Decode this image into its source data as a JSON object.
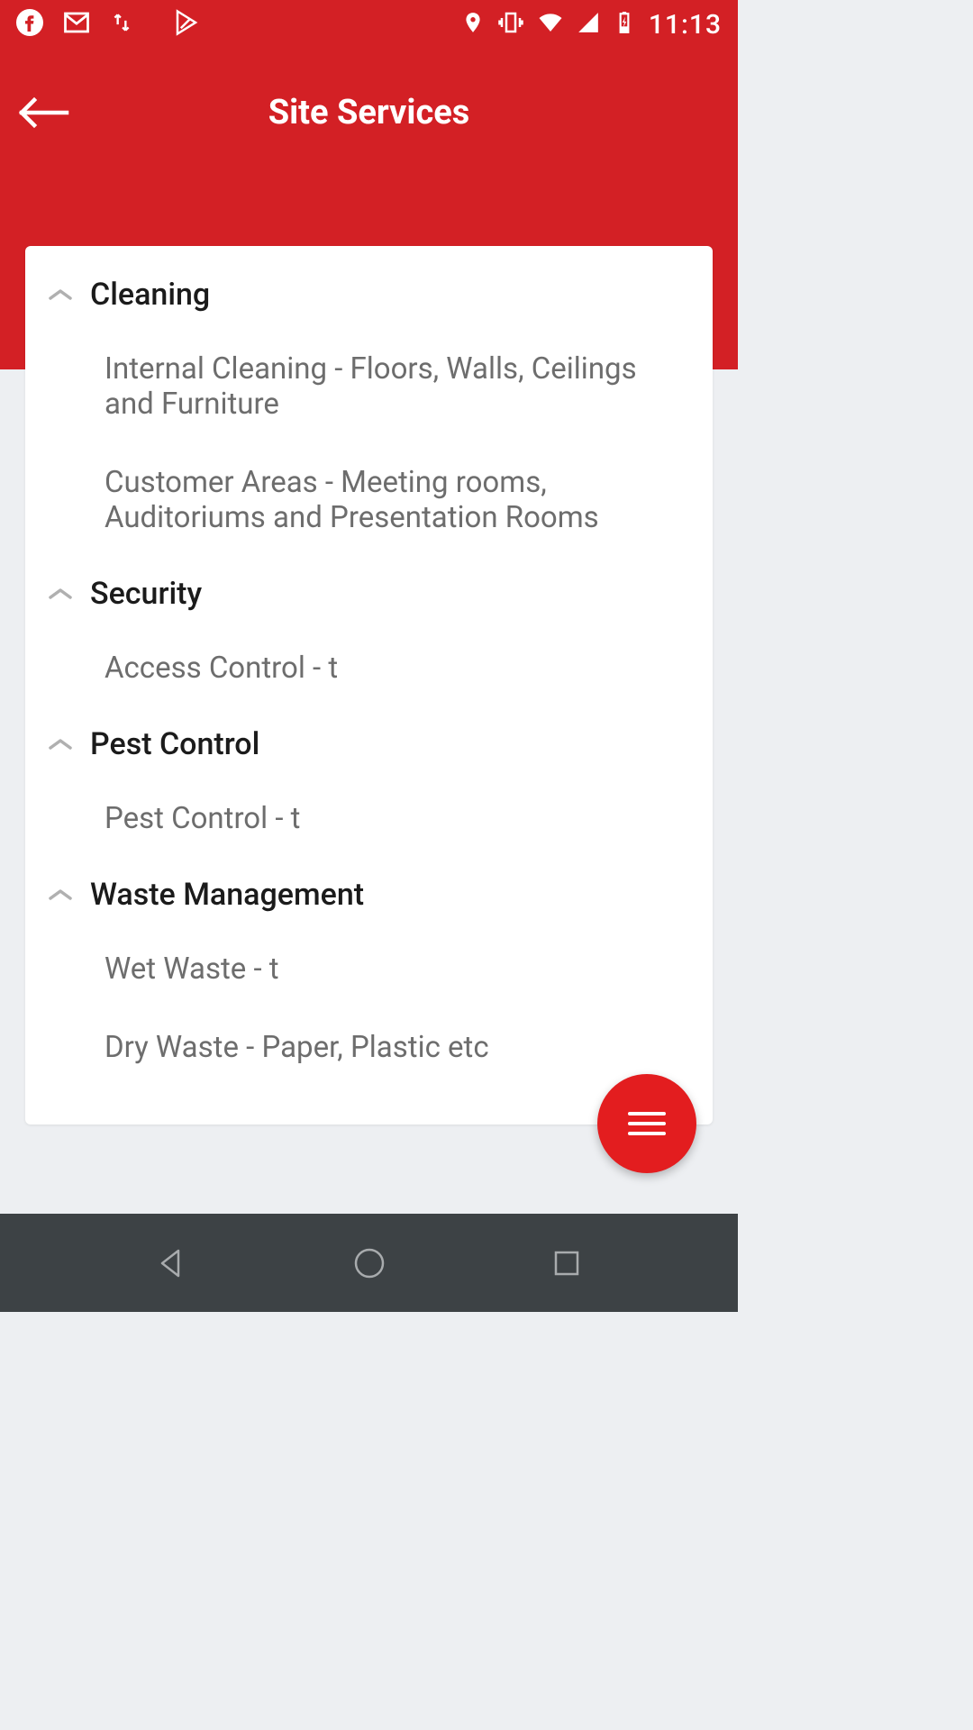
{
  "status_bar": {
    "time": "11:13"
  },
  "header": {
    "title": "Site Services"
  },
  "sections": [
    {
      "title": "Cleaning",
      "items": [
        "Internal Cleaning - Floors, Walls, Ceilings and Furniture",
        "Customer Areas - Meeting rooms, Auditoriums and Presentation Rooms"
      ]
    },
    {
      "title": "Security",
      "items": [
        "Access Control - t"
      ]
    },
    {
      "title": "Pest Control",
      "items": [
        "Pest Control - t"
      ]
    },
    {
      "title": "Waste Management",
      "items": [
        "Wet Waste - t",
        "Dry Waste - Paper, Plastic etc"
      ]
    }
  ]
}
